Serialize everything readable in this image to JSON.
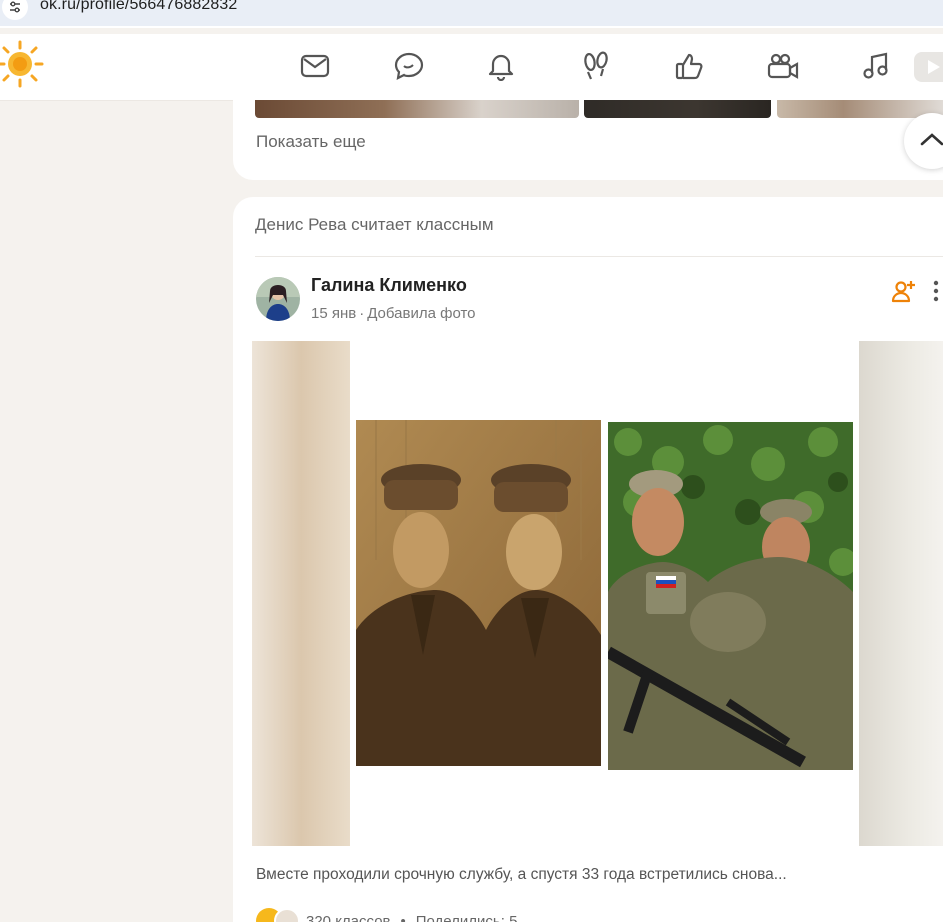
{
  "browser": {
    "url": "ok.ru/profile/566476882832"
  },
  "nav": {
    "icons": [
      "envelope-icon",
      "chat-bubble-icon",
      "bell-icon",
      "footprints-icon",
      "thumbs-up-icon",
      "video-camera-icon",
      "music-note-icon"
    ]
  },
  "prev_card": {
    "show_more": "Показать еще"
  },
  "post": {
    "liked_by": "Денис Рева считает классным",
    "author": "Галина Клименко",
    "date": "15 янв",
    "action": "Добавила фото",
    "caption": "Вместе проходили срочную службу, а спустя 33 года встретились снова...",
    "likes": "320 классов",
    "shares": "Поделились: 5"
  },
  "colors": {
    "accent": "#ee8208",
    "text": "#222222",
    "muted": "#777777",
    "bg": "#f5f2ee"
  }
}
